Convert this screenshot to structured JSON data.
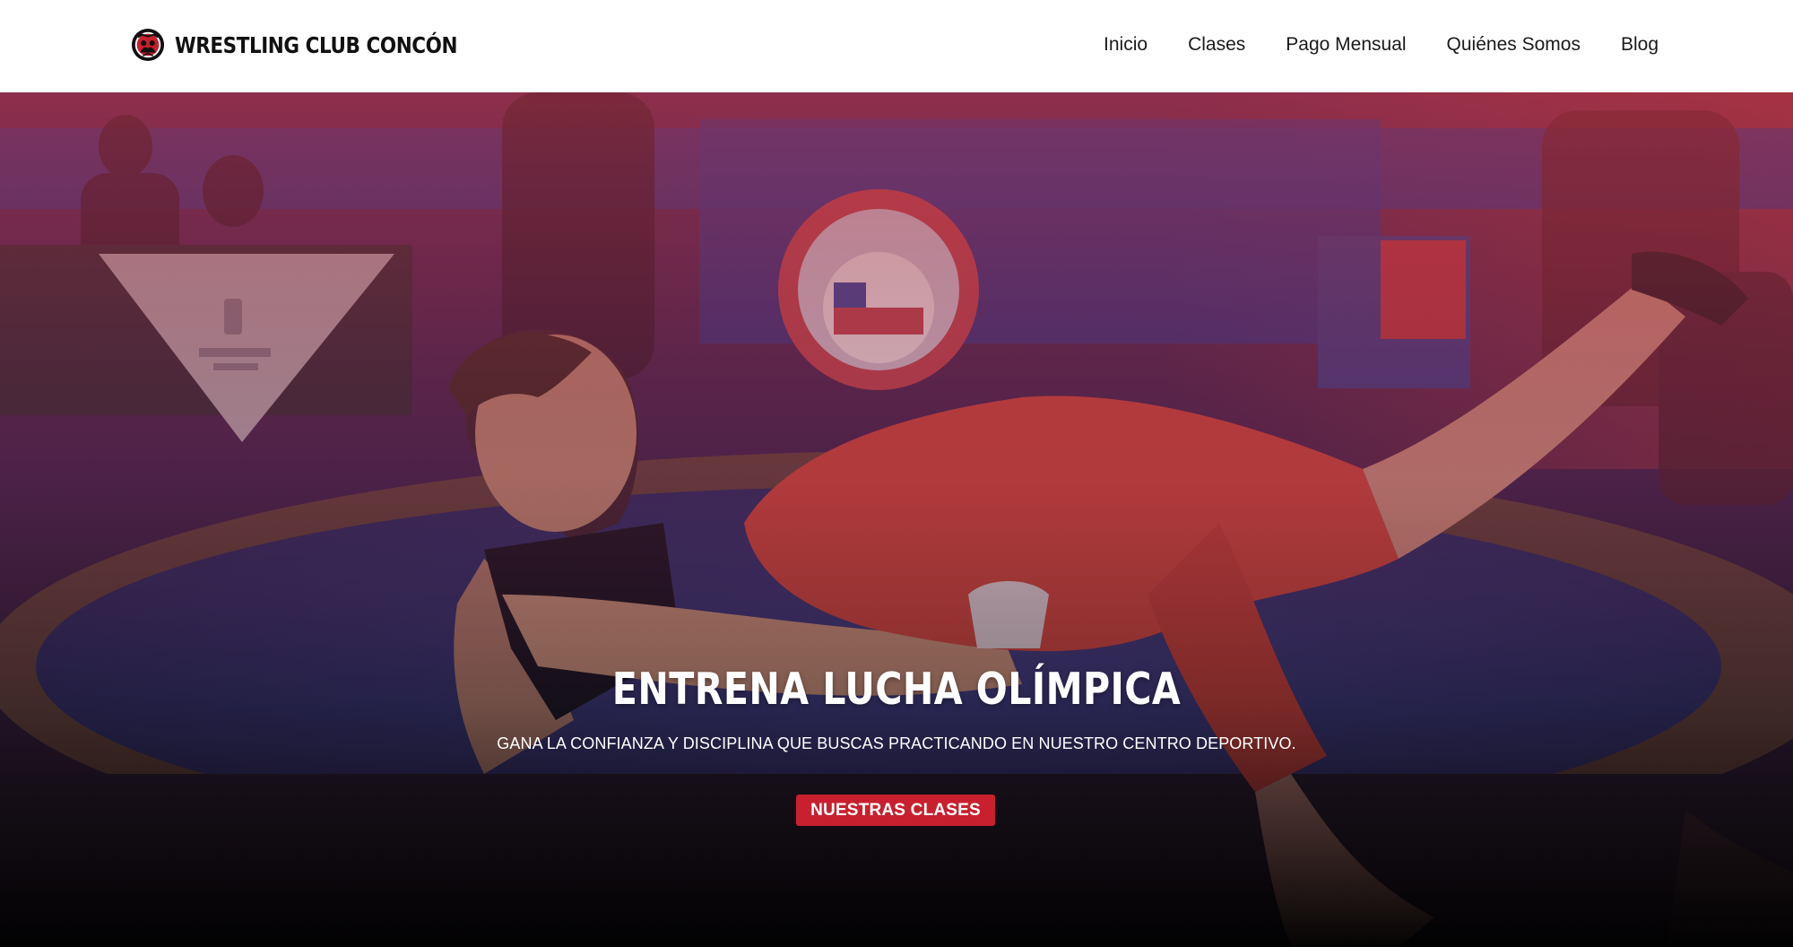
{
  "header": {
    "brand_name": "WRESTLING CLUB CONCÓN",
    "logo_icon": "wrestling-club-logo-icon",
    "nav": [
      {
        "label": "Inicio"
      },
      {
        "label": "Clases"
      },
      {
        "label": "Pago Mensual"
      },
      {
        "label": "Quiénes Somos"
      },
      {
        "label": "Blog"
      }
    ]
  },
  "hero": {
    "title": "ENTRENA LUCHA OLÍMPICA",
    "subtitle": "GANA LA CONFIANZA Y DISCIPLINA QUE BUSCAS PRACTICANDO EN NUESTRO CENTRO DEPORTIVO.",
    "cta_label": "NUESTRAS CLASES",
    "background_image": "wrestling-match-photo",
    "overlay_color_top": "#b8323f",
    "overlay_color_bottom": "#000000"
  },
  "colors": {
    "accent": "#c8202e",
    "header_bg": "#ffffff",
    "nav_text": "#1a1a1a",
    "hero_text": "#ffffff"
  }
}
